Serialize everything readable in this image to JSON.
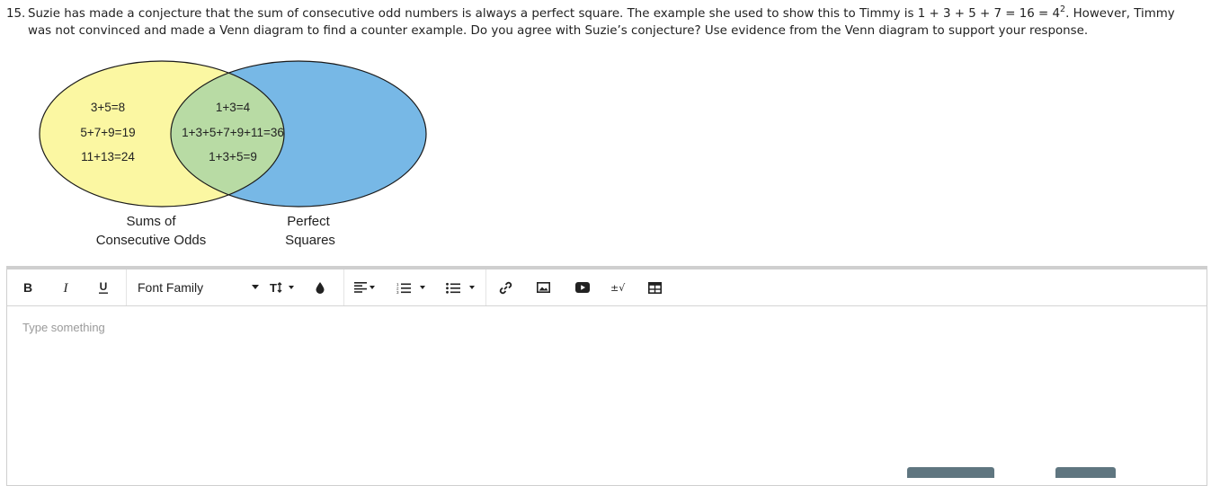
{
  "question": {
    "number": "15.",
    "line1_pre": "Suzie has made a conjecture that the sum of consecutive odd numbers is always a perfect square. The example she used to show this to Timmy is 1 + 3 + 5 + 7 = 16 = 4",
    "line1_sup": "2",
    "line1_post": ". However, Timmy",
    "line2": "was not convinced and made a Venn diagram to find a counter example. Do you agree with Suzie’s conjecture? Use evidence from the Venn diagram to support your response."
  },
  "venn": {
    "left_only": [
      "3+5=8",
      "5+7+9=19",
      "11+13=24"
    ],
    "overlap": [
      "1+3=4",
      "1+3+5+7+9+11=36",
      "1+3+5=9"
    ],
    "left_label": [
      "Sums of",
      "Consecutive Odds"
    ],
    "right_label": [
      "Perfect",
      "Squares"
    ],
    "colors": {
      "left": "#fbf7a2",
      "right": "#77b8e6",
      "overlap": "#b8dba4"
    }
  },
  "editor": {
    "font_family_label": "Font Family",
    "placeholder": "Type something",
    "tools": [
      "bold-icon",
      "italic-icon",
      "underline-icon",
      "text-size-icon",
      "text-color-icon",
      "align-icon",
      "ordered-list-icon",
      "unordered-list-icon",
      "link-icon",
      "image-icon",
      "video-icon",
      "math-icon",
      "table-icon"
    ]
  }
}
